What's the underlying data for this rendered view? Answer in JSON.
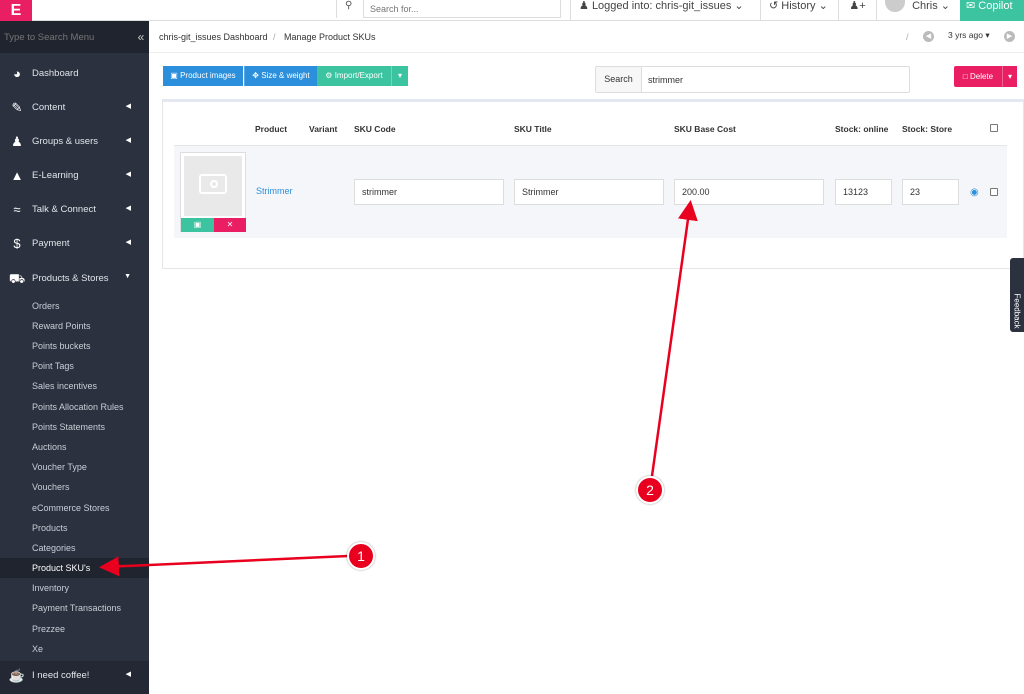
{
  "topbar": {
    "search_placeholder": "Search for...",
    "logged_into": "Logged into: chris-git_issues",
    "history": "History",
    "user": "Chris",
    "copilot": "Copilot"
  },
  "sidebar": {
    "search_placeholder": "Type to Search Menu",
    "items": [
      {
        "label": "Dashboard"
      },
      {
        "label": "Content"
      },
      {
        "label": "Groups & users"
      },
      {
        "label": "E-Learning"
      },
      {
        "label": "Talk & Connect"
      },
      {
        "label": "Payment"
      },
      {
        "label": "Products & Stores"
      }
    ],
    "sub_items": [
      "Orders",
      "Reward Points",
      "Points buckets",
      "Point Tags",
      "Sales incentives",
      "Points Allocation Rules",
      "Points Statements",
      "Auctions",
      "Voucher Type",
      "Vouchers",
      "eCommerce Stores",
      "Products",
      "Categories",
      "Product SKU's",
      "Inventory",
      "Payment Transactions",
      "Prezzee",
      "Xe"
    ],
    "bottom_item": "I need coffee!"
  },
  "breadcrumb": {
    "dashboard": "chris-git_issues Dashboard",
    "current": "Manage Product SKUs",
    "time_ago": "3 yrs ago"
  },
  "toolbar": {
    "product_images": "Product images",
    "size_weight": "Size & weight",
    "import_export": "Import/Export",
    "delete": "Delete"
  },
  "search": {
    "label": "Search",
    "value": "strimmer"
  },
  "table": {
    "headers": [
      "Product",
      "Variant",
      "SKU Code",
      "SKU Title",
      "SKU Base Cost",
      "Stock: online",
      "Stock: Store"
    ],
    "rows": [
      {
        "product": "Strimmer",
        "sku_code": "strimmer",
        "sku_title": "Strimmer",
        "base_cost": "200.00",
        "stock_online": "13123",
        "stock_store": "23"
      }
    ]
  },
  "feedback": "Feedback",
  "annotations": [
    "1",
    "2"
  ],
  "colors": {
    "accent": "#e91e63",
    "primary": "#2c8fdc",
    "success": "#3cc4a0",
    "sidebar": "#2b313f",
    "annotation": "#e8001e"
  }
}
